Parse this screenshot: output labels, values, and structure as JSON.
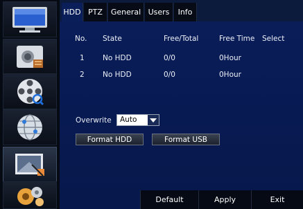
{
  "sidebar": {
    "items": [
      {
        "icon": "monitor-icon"
      },
      {
        "icon": "camera-settings-icon"
      },
      {
        "icon": "film-reel-icon"
      },
      {
        "icon": "network-globe-icon"
      },
      {
        "icon": "storage-screen-icon"
      },
      {
        "icon": "system-gears-icon"
      }
    ]
  },
  "tabs": [
    {
      "label": "HDD"
    },
    {
      "label": "PTZ"
    },
    {
      "label": "General"
    },
    {
      "label": "Users"
    },
    {
      "label": "Info"
    }
  ],
  "table": {
    "headers": [
      "No.",
      "State",
      "Free/Total",
      "Free Time",
      "Select"
    ],
    "rows": [
      {
        "no": "1",
        "state": "No HDD",
        "free_total": "0/0",
        "free_time": "0Hour"
      },
      {
        "no": "2",
        "state": "No HDD",
        "free_total": "0/0",
        "free_time": "0Hour"
      }
    ]
  },
  "overwrite": {
    "label": "Overwrite",
    "value": "Auto"
  },
  "buttons": {
    "format_hdd": "Format HDD",
    "format_usb": "Format USB"
  },
  "footer": {
    "default": "Default",
    "apply": "Apply",
    "exit": "Exit"
  }
}
